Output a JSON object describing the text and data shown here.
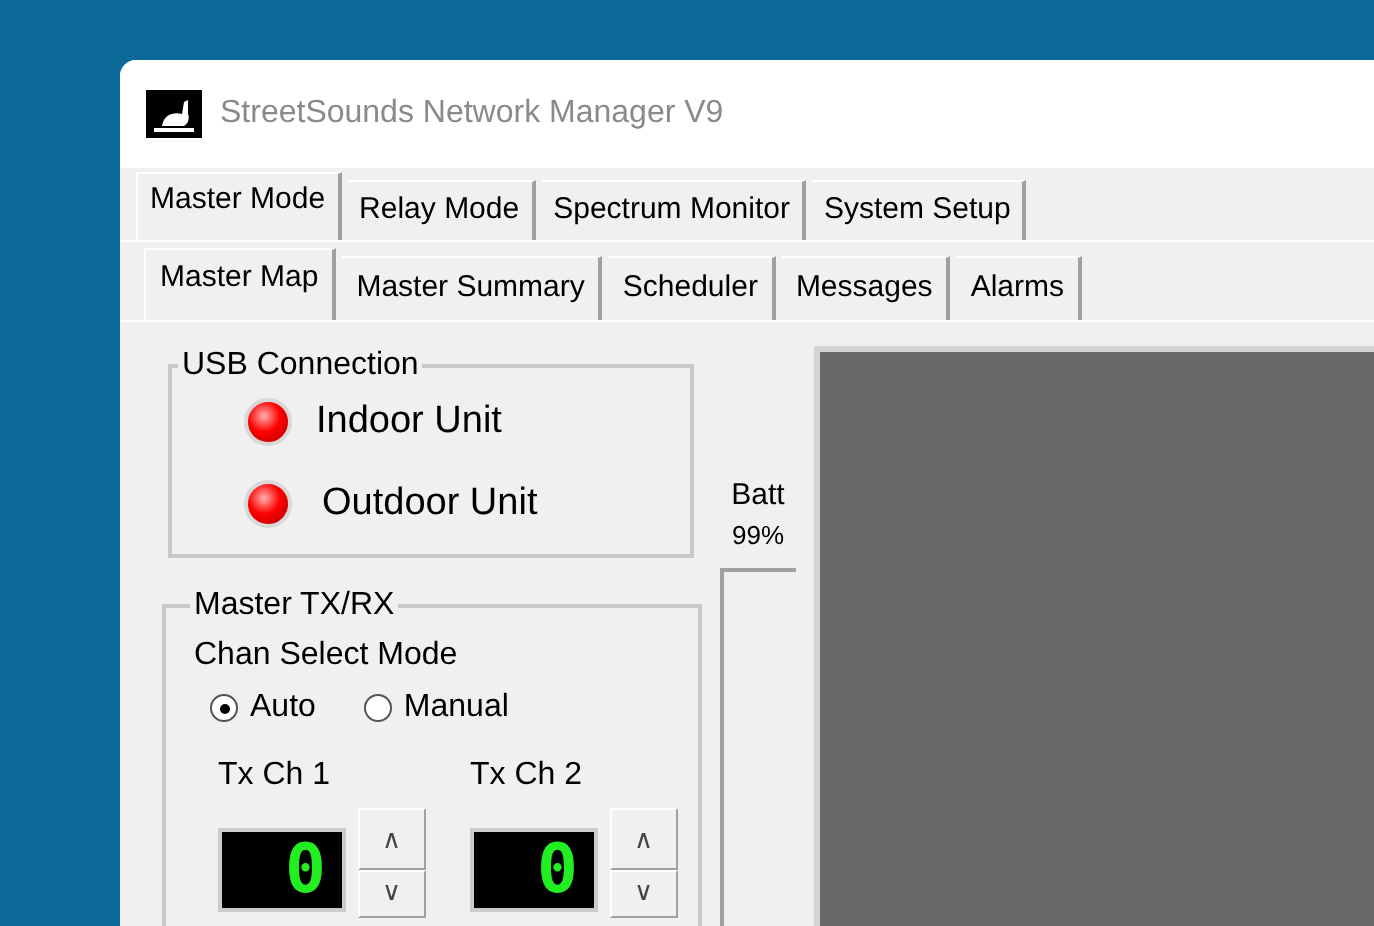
{
  "window": {
    "title": "StreetSounds Network Manager V9"
  },
  "tabs": [
    {
      "label": "Master Mode",
      "selected": true
    },
    {
      "label": "Relay Mode",
      "selected": false
    },
    {
      "label": "Spectrum Monitor",
      "selected": false
    },
    {
      "label": "System Setup",
      "selected": false
    }
  ],
  "subtabs": [
    {
      "label": "Master Map",
      "selected": true
    },
    {
      "label": "Master Summary",
      "selected": false
    },
    {
      "label": "Scheduler",
      "selected": false
    },
    {
      "label": "Messages",
      "selected": false
    },
    {
      "label": "Alarms",
      "selected": false
    }
  ],
  "usb_connection": {
    "title": "USB Connection",
    "units": [
      {
        "label": "Indoor Unit",
        "lit": true
      },
      {
        "label": "Outdoor Unit",
        "lit": true
      }
    ]
  },
  "battery": {
    "label": "Batt",
    "reading": "99%"
  },
  "master_txrx": {
    "title": "Master TX/RX",
    "mode_label": "Chan Select Mode",
    "modes": [
      {
        "label": "Auto",
        "selected": true
      },
      {
        "label": "Manual",
        "selected": false
      }
    ],
    "channels": [
      {
        "label": "Tx Ch 1",
        "value": "0",
        "up": "∧",
        "down": "∨"
      },
      {
        "label": "Tx Ch 2",
        "value": "0",
        "up": "∧",
        "down": "∨"
      }
    ]
  }
}
